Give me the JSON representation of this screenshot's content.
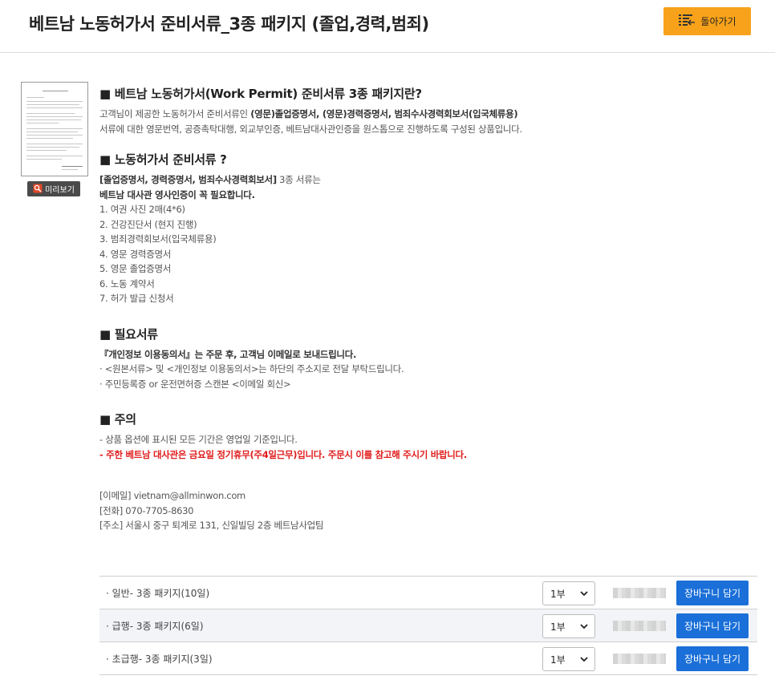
{
  "header": {
    "title": "베트남 노동허가서 준비서류_3종 패키지 (졸업,경력,범죄)",
    "back_label": "돌아가기"
  },
  "preview": {
    "label": "미리보기"
  },
  "sections": {
    "s1": {
      "title": "■ 베트남 노동허가서(Work Permit) 준비서류 3종 패키지란?",
      "l1_pre": "고객님이 제공한 노동허가서 준비서류인 ",
      "l1_bold": "(영문)졸업증명서, (영문)경력증명서, 범죄수사경력회보서(입국체류용)",
      "l2": "서류에 대한 영문번역, 공증촉탁대행, 외교부인증, 베트남대사관인증을 원스톱으로 진행하도록 구성된 상품입니다."
    },
    "s2": {
      "title": "■ 노동허가서 준비서류 ?",
      "b1_bold": "[졸업증명서, 경력증명서, 범죄수사경력회보서]",
      "b1_rest": " 3종 서류는",
      "b2": "베트남 대사관 영사인증이 꼭 필요합니다.",
      "items": [
        "1. 여권 사진 2매(4*6)",
        "2. 건강진단서 (현지 진행)",
        "3. 범죄경력회보서(입국체류용)",
        "4. 영문 경력증명서",
        "5. 영문 졸업증명서",
        "6. 노동 계약서",
        "7. 허가 발급 신청서"
      ]
    },
    "s3": {
      "title": "■ 필요서류",
      "l1": "『개인정보 이용동의서』는 주문 후, 고객님 이메일로 보내드립니다.",
      "l2": "· <원본서류> 및 <개인정보 이용동의서>는 하단의 주소지로 전달 부탁드립니다.",
      "l3": "· 주민등록증 or 운전면허증 스캔본 <이메일 회신>"
    },
    "s4": {
      "title": "■ 주의",
      "l1": "- 상품 옵션에 표시된 모든 기간은 영업일 기준입니다.",
      "l2": "- 주한 베트남 대사관은 금요일 정기휴무(주4일근무)입니다. 주문시 이를 참고해 주시기 바랍니다."
    }
  },
  "contact": {
    "email": "[이메일] vietnam@allminwon.com",
    "phone": "[전화] 070-7705-8630",
    "address": "[주소] 서울시 중구 퇴계로 131, 신일빌딩 2층 베트남사업팀"
  },
  "options": [
    {
      "label": "· 일반- 3종 패키지(10일)",
      "qty": "1부",
      "cart": "장바구니 담기"
    },
    {
      "label": "· 급행- 3종 패키지(6일)",
      "qty": "1부",
      "cart": "장바구니 담기"
    },
    {
      "label": "· 초급행- 3종 패키지(3일)",
      "qty": "1부",
      "cart": "장바구니 담기"
    }
  ],
  "colors": {
    "accent": "#f7a21a",
    "cart": "#1a6fd8",
    "warning": "#e01b1b"
  },
  "icons": {
    "back": "list-back-icon",
    "preview": "magnifier-icon",
    "select": "chevron-down-icon"
  }
}
